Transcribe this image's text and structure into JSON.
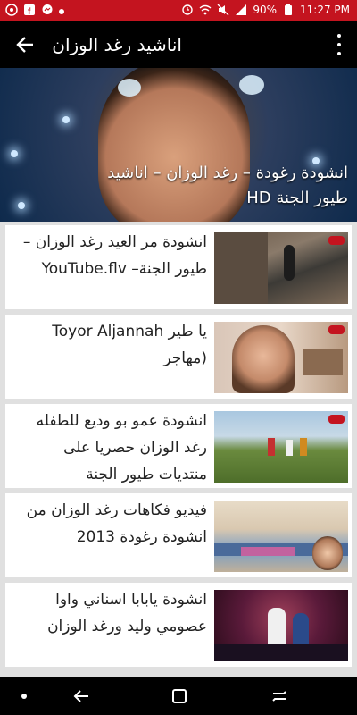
{
  "status_bar": {
    "time": "11:27 PM",
    "battery": "90%"
  },
  "app_bar": {
    "title": "اناشيد رغد الوزان"
  },
  "hero": {
    "caption": "انشودة رغودة – رغد الوزان – اناشيد طيور الجنة HD"
  },
  "videos": [
    {
      "title": "انشودة مر العيد رغد الوزان –طيور الجنة– YouTube.flv"
    },
    {
      "title": "يا طير Toyor Aljannah (مهاجر"
    },
    {
      "title": "انشودة عمو بو وديع للطفله رغد الوزان حصريا على منتديات طيور الجنة"
    },
    {
      "title": "فيديو فكاهات رغد الوزان من انشودة رغودة 2013"
    },
    {
      "title": "انشودة يابابا اسناني واوا عصومي وليد ورغد الوزان"
    }
  ],
  "colors": {
    "status_bar": "#c4141f",
    "app_bar": "#000000",
    "list_bg": "#e0e0e0"
  }
}
